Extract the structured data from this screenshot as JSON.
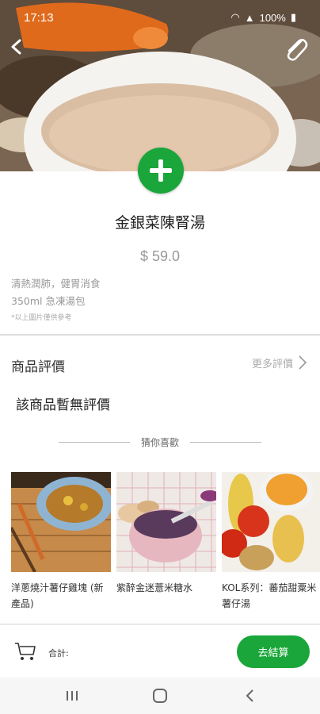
{
  "status_bar": {
    "time": "17:13",
    "battery": "100%"
  },
  "product": {
    "name": "金銀菜陳腎湯",
    "price": "$ 59.0",
    "description_line1": "清熱潤肺，健胃消食",
    "description_line2": "350ml 急凍湯包",
    "image_note": "*以上圖片僅供參考"
  },
  "reviews": {
    "title": "商品評價",
    "more_label": "更多評價",
    "empty_text": "該商品暫無評價"
  },
  "recommendations": {
    "title": "猜你喜歡",
    "items": [
      {
        "label": "洋蔥燒汁薯仔雞塊 (新產品)"
      },
      {
        "label": "紫醉金迷薏米糖水"
      },
      {
        "label": "KOL系列：蕃茄甜粟米薯仔湯"
      }
    ]
  },
  "bottom_bar": {
    "total_label": "合計:",
    "checkout_label": "去結算"
  },
  "colors": {
    "accent": "#1aa63a"
  },
  "icons": [
    "back-arrow-icon",
    "paperclip-icon",
    "plus-icon",
    "chevron-right-icon",
    "cart-icon",
    "recent-apps-icon",
    "home-icon",
    "back-icon"
  ]
}
